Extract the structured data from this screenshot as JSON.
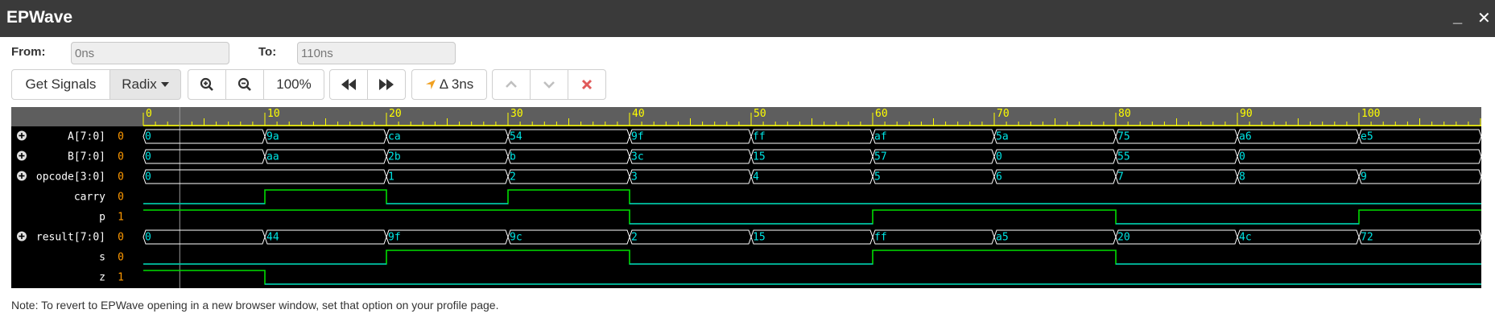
{
  "app": {
    "title": "EPWave",
    "minimize": "_",
    "close": "✕"
  },
  "range": {
    "from_label": "From:",
    "from_value": "0ns",
    "to_label": "To:",
    "to_value": "110ns"
  },
  "toolbar": {
    "get_signals": "Get Signals",
    "radix": "Radix",
    "zoom_in_icon": "zoom-in-icon",
    "zoom_out_icon": "zoom-out-icon",
    "zoom_level": "100%",
    "prev_icon": "rewind-icon",
    "next_icon": "fast-forward-icon",
    "cursor_delta": "Δ 3ns",
    "up_icon": "chevron-up-icon",
    "down_icon": "chevron-down-icon",
    "remove_icon": "close-icon"
  },
  "colors": {
    "bus": "#00e5e5",
    "bit": "#00dd00",
    "bit_low": "#00bfbf",
    "value": "#ff9900",
    "timeline": "#ffff00",
    "header": "#5e5e5e"
  },
  "waveform": {
    "time_range": [
      0,
      110
    ],
    "major_ticks": [
      0,
      10,
      20,
      30,
      40,
      50,
      60,
      70,
      80,
      90,
      100
    ],
    "cursor_time": 3,
    "signals": [
      {
        "name": "A[7:0]",
        "value": "0",
        "type": "bus",
        "expandable": true,
        "changes": [
          [
            0,
            "0"
          ],
          [
            10,
            "9a"
          ],
          [
            20,
            "ca"
          ],
          [
            30,
            "54"
          ],
          [
            40,
            "9f"
          ],
          [
            50,
            "ff"
          ],
          [
            60,
            "af"
          ],
          [
            70,
            "5a"
          ],
          [
            80,
            "75"
          ],
          [
            90,
            "a6"
          ],
          [
            100,
            "e5"
          ]
        ]
      },
      {
        "name": "B[7:0]",
        "value": "0",
        "type": "bus",
        "expandable": true,
        "changes": [
          [
            0,
            "0"
          ],
          [
            10,
            "aa"
          ],
          [
            20,
            "2b"
          ],
          [
            30,
            "b"
          ],
          [
            40,
            "3c"
          ],
          [
            50,
            "15"
          ],
          [
            60,
            "57"
          ],
          [
            70,
            "0"
          ],
          [
            80,
            "55"
          ],
          [
            90,
            "0"
          ]
        ]
      },
      {
        "name": "opcode[3:0]",
        "value": "0",
        "type": "bus",
        "expandable": true,
        "changes": [
          [
            0,
            "0"
          ],
          [
            20,
            "1"
          ],
          [
            30,
            "2"
          ],
          [
            40,
            "3"
          ],
          [
            50,
            "4"
          ],
          [
            60,
            "5"
          ],
          [
            70,
            "6"
          ],
          [
            80,
            "7"
          ],
          [
            90,
            "8"
          ],
          [
            100,
            "9"
          ]
        ]
      },
      {
        "name": "carry",
        "value": "0",
        "type": "bit",
        "expandable": false,
        "changes": [
          [
            0,
            0
          ],
          [
            10,
            1
          ],
          [
            20,
            0
          ],
          [
            30,
            1
          ],
          [
            40,
            0
          ]
        ]
      },
      {
        "name": "p",
        "value": "1",
        "type": "bit",
        "expandable": false,
        "changes": [
          [
            0,
            1
          ],
          [
            40,
            0
          ],
          [
            60,
            1
          ],
          [
            80,
            0
          ],
          [
            100,
            1
          ]
        ]
      },
      {
        "name": "result[7:0]",
        "value": "0",
        "type": "bus",
        "expandable": true,
        "changes": [
          [
            0,
            "0"
          ],
          [
            10,
            "44"
          ],
          [
            20,
            "9f"
          ],
          [
            30,
            "9c"
          ],
          [
            40,
            "2"
          ],
          [
            50,
            "15"
          ],
          [
            60,
            "ff"
          ],
          [
            70,
            "a5"
          ],
          [
            80,
            "20"
          ],
          [
            90,
            "4c"
          ],
          [
            100,
            "72"
          ]
        ]
      },
      {
        "name": "s",
        "value": "0",
        "type": "bit",
        "expandable": false,
        "changes": [
          [
            0,
            0
          ],
          [
            20,
            1
          ],
          [
            40,
            0
          ],
          [
            60,
            1
          ],
          [
            80,
            0
          ]
        ]
      },
      {
        "name": "z",
        "value": "1",
        "type": "bit",
        "expandable": false,
        "changes": [
          [
            0,
            1
          ],
          [
            10,
            0
          ]
        ]
      }
    ]
  },
  "note": "Note: To revert to EPWave opening in a new browser window, set that option on your profile page."
}
